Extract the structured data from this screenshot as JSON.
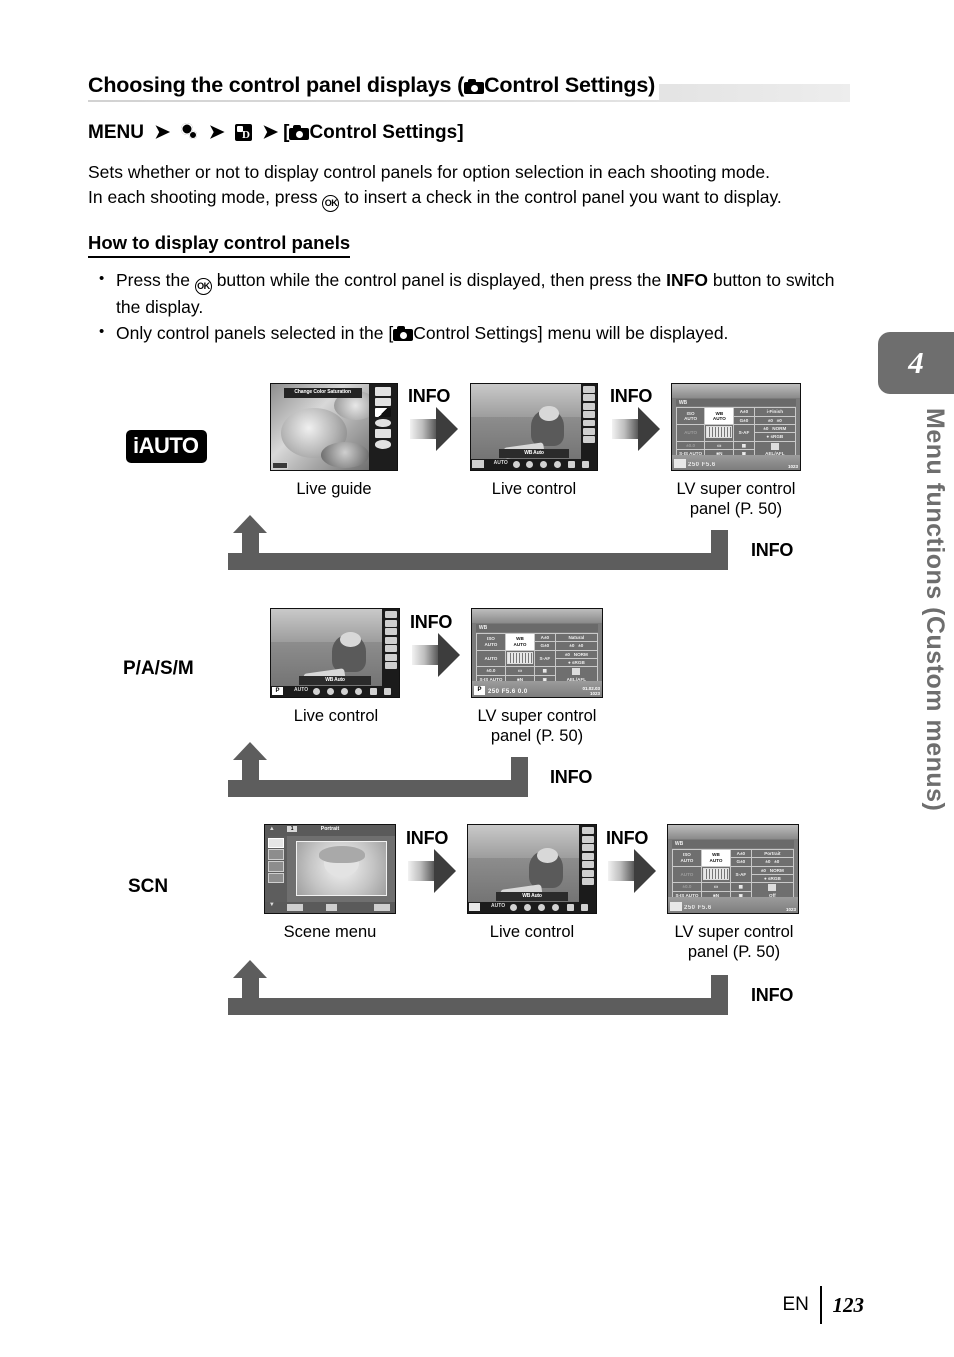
{
  "page": {
    "heading": "Choosing the control panel displays (",
    "heading_tail": "Control Settings)",
    "menu_path_prefix": "MENU",
    "menu_path_tail": "Control Settings]",
    "menu_bracket_open": "[",
    "body_line1": "Sets whether or not to display control panels for option selection in each shooting mode.",
    "body_line2_a": "In each shooting mode, press",
    "body_line2_b": "to insert a check in the control panel you want to display.",
    "ok_icon_label": "OK",
    "subheading": "How to display control panels",
    "bullets": [
      {
        "a": "Press the",
        "b": "button while the control panel is displayed, then press the",
        "info": "INFO",
        "c": "button to switch the display."
      },
      {
        "a": "Only control panels selected in the [",
        "b": "Control Settings] menu will be displayed."
      }
    ],
    "chapter_number": "4",
    "chapter_title": "Menu functions (Custom menus)",
    "footer_lang": "EN",
    "footer_page": "123"
  },
  "diagram": {
    "info_label": "INFO",
    "rows": [
      {
        "mode": "iAUTO",
        "mode_style": "badge",
        "captions": [
          "Live guide",
          "Live control",
          "LV super control panel (P. 50)"
        ]
      },
      {
        "mode": "P/A/S/M",
        "mode_style": "plain",
        "captions": [
          "Live control",
          "LV super control panel (P. 50)"
        ]
      },
      {
        "mode": "SCN",
        "mode_style": "plain",
        "captions": [
          "Scene menu",
          "Live control",
          "LV super control panel (P. 50)"
        ]
      }
    ]
  },
  "screens": {
    "live_guide": {
      "banner": "Change Color Saturation",
      "icon_count": 6
    },
    "live_control": {
      "wb_label": "WB Auto",
      "mode_badge_iauto": "iA",
      "mode_badge_pasm": "P",
      "mode_badge_scn": "SCN",
      "bottom_first": "AUTO"
    },
    "scene_menu": {
      "number": "1",
      "title": "Portrait"
    },
    "super_control_panel_iauto": {
      "header": "WB",
      "cells": [
        [
          "ISO AUTO",
          "WB AUTO",
          "A±0",
          "i-Finish"
        ],
        [
          "",
          "",
          "G±0",
          "±0   ±0"
        ],
        [
          "AUTO",
          "",
          "S-AF",
          "±0   NORM"
        ],
        [
          "",
          "",
          "",
          "sRGB"
        ],
        [
          "±0.0",
          "",
          "",
          ""
        ],
        [
          "S-IS AUTO",
          "N",
          "",
          "AEL/AFL"
        ]
      ],
      "iso": "ISO",
      "iso_val": "AUTO",
      "wb": "WB",
      "wb_val": "AUTO",
      "a_val": "A±0",
      "g_val": "G±0",
      "picture_mode": "i-Finish",
      "af_mode": "S-AF",
      "norm": "NORM",
      "srgb": "sRGB",
      "is_mode": "S-IS AUTO",
      "ael": "AEL/AFL",
      "flash": "AUTO",
      "exp": "±0.0",
      "shutter": "250",
      "aperture": "F5.6",
      "count": "1023"
    },
    "super_control_panel_pasm": {
      "header": "WB",
      "picture_mode": "Natural",
      "mode_badge": "P",
      "shutter": "250",
      "aperture": "F5.6",
      "exposure": "0.0",
      "date": "01.02.03",
      "count": "1023"
    },
    "super_control_panel_scn": {
      "header": "WB",
      "picture_mode": "Portrait",
      "off": "Off",
      "count": "1023"
    }
  },
  "colors": {
    "arrow_gray": "#5d5d5d",
    "chapter_gray": "#6e6e6e",
    "heading_bar": "#dcdcdc"
  }
}
